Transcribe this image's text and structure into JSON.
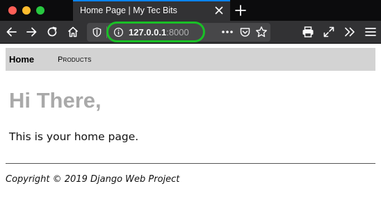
{
  "browser": {
    "tab": {
      "title": "Home Page | My Tec Bits",
      "close_icon": "close-icon"
    },
    "new_tab_icon": "plus-icon",
    "toolbar": {
      "back_icon": "back-arrow-icon",
      "forward_icon": "forward-arrow-icon",
      "reload_icon": "reload-icon",
      "home_icon": "home-icon",
      "shield_icon": "tracking-shield-icon",
      "info_icon": "info-icon",
      "url_host": "127.0.0.1",
      "url_port": ":8000",
      "page_actions_icon": "more-dots-icon",
      "pocket_icon": "pocket-icon",
      "bookmark_icon": "star-icon",
      "print_icon": "print-icon",
      "fullscreen_icon": "fullscreen-icon",
      "overflow_icon": "overflow-chevrons-icon",
      "menu_icon": "hamburger-menu-icon"
    },
    "highlight_color": "#19c026"
  },
  "page": {
    "nav": {
      "home": "Home",
      "products": "Products"
    },
    "heading": "Hi There,",
    "message": "This is your home page.",
    "footer": "Copyright © 2019 Django Web Project"
  }
}
